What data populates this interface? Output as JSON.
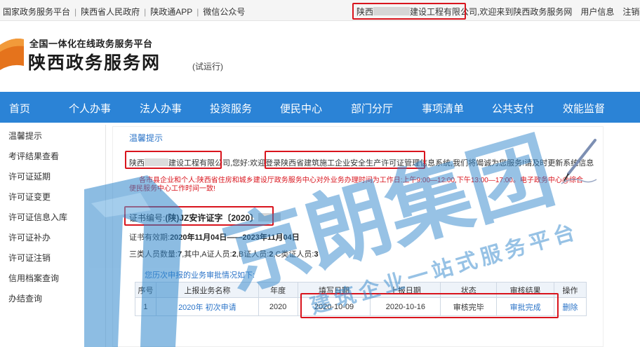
{
  "topbar": {
    "links": [
      "国家政务服务平台",
      "陕西省人民政府",
      "陕政通APP",
      "微信公众号"
    ],
    "company_prefix": "陕西",
    "company_suffix": "建设工程有限公司",
    "welcome": "欢迎来到陕西政务服务网",
    "user_info": "用户信息",
    "logout": "注销"
  },
  "header": {
    "subtitle": "全国一体化在线政务服务平台",
    "title": "陕西政务服务网",
    "trial": "(试运行)"
  },
  "nav": {
    "items": [
      "首页",
      "个人办事",
      "法人办事",
      "投资服务",
      "便民中心",
      "部门分厅",
      "事项清单",
      "公共支付",
      "效能监督"
    ]
  },
  "sidebar": {
    "items": [
      "温馨提示",
      "考评结果查看",
      "许可证延期",
      "许可证变更",
      "许可证信息入库",
      "许可证补办",
      "许可证注销",
      "信用档案查询",
      "办结查询"
    ]
  },
  "content": {
    "title": "温馨提示",
    "greet_prefix": "陕西",
    "greet_company": "建设工程有限公司",
    "greet_text": ",您好:欢迎登录陕西省建筑施工企业安全生产许可证管理信息系统,我们将竭诚为您服务!请及时更新系统信息",
    "notice_line1": "各市县企业和个人:陕西省住房和城乡建设厅政务服务中心对外业务办理时间为工作日:上午9:00—12:00,下午13:00—17:00。电子政务中心@综合",
    "notice_line2": "便民服务中心工作时间一致!",
    "cert_label": "证书编号:",
    "cert_value": "(陕)JZ安许证字〔2020〕",
    "valid_label": "证书有效期:",
    "valid_value": "2020年11月04日——2023年11月04日",
    "staff_text": "三类人员数量:",
    "staff_total": "7",
    "staff_sep": ",其中,A证人员:",
    "staff_a": "2",
    "staff_b_label": ",B证人员:",
    "staff_b": "2",
    "staff_c_label": ",C类证人员:",
    "staff_c": "3",
    "history": "您历次申报的业务审批情况如下:"
  },
  "table": {
    "headers": [
      "序号",
      "上报业务名称",
      "年度",
      "填写日期",
      "上报日期",
      "状态",
      "审核结果",
      "操作"
    ],
    "rows": [
      [
        "1",
        "2020年 初次申请",
        "2020",
        "2020-10-09",
        "2020-10-16",
        "审核完毕",
        "审批完成",
        "删除"
      ]
    ]
  },
  "watermark": {
    "brand": "京朗集团",
    "slogan": "建筑企业一站式服务平台"
  }
}
